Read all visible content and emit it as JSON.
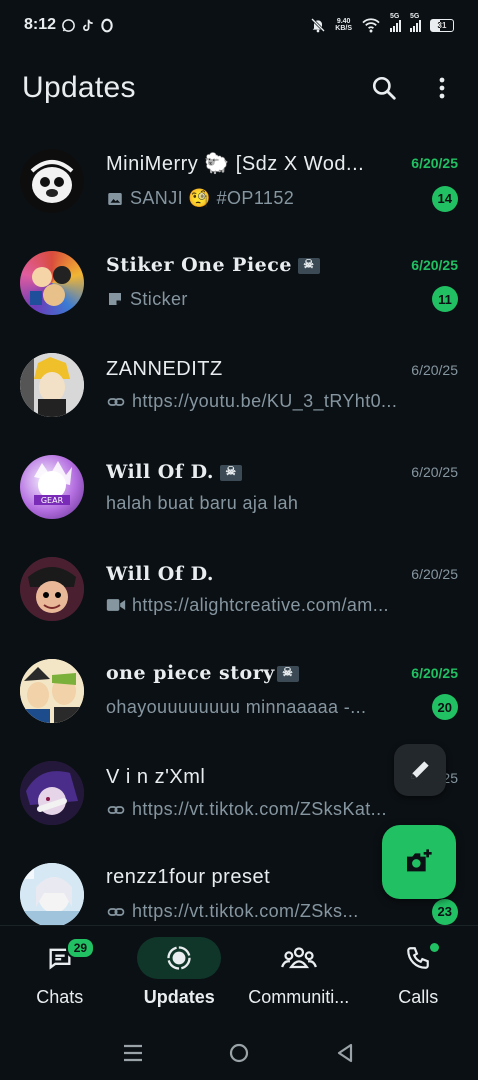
{
  "status_bar": {
    "time": "8:12",
    "net_speed_value": "9.40",
    "net_speed_unit": "KB/S",
    "sim1_label": "5G",
    "sim2_label": "5G",
    "battery": "31"
  },
  "header": {
    "title": "Updates"
  },
  "chats": [
    {
      "name": "MiniMerry 🐑 [Sdz X Wod...",
      "preview": "SANJI 🧐 #OP1152",
      "time": "6/20/25",
      "unread": "14",
      "preview_icon": "image-icon"
    },
    {
      "name": "Stiker One Piece",
      "preview": "Sticker",
      "time": "6/20/25",
      "unread": "11",
      "preview_icon": "sticker-icon"
    },
    {
      "name": "ZANNEDITZ",
      "preview": "https://youtu.be/KU_3_tRYht0...",
      "time": "6/20/25",
      "unread": "",
      "preview_icon": "link-icon"
    },
    {
      "name": "Will Of D.",
      "preview": "halah buat baru aja lah",
      "time": "6/20/25",
      "unread": "",
      "preview_icon": ""
    },
    {
      "name": "Will Of D.",
      "preview": "https://alightcreative.com/am...",
      "time": "6/20/25",
      "unread": "",
      "preview_icon": "video-icon"
    },
    {
      "name": "one piece story",
      "preview": "ohayouuuuuuuu minnaaaaa  -...",
      "time": "6/20/25",
      "unread": "20",
      "preview_icon": ""
    },
    {
      "name": "V i n z'Xml",
      "preview": "https://vt.tiktok.com/ZSksKat...",
      "time": "25",
      "unread": "",
      "preview_icon": "link-icon"
    },
    {
      "name": "renzz1four preset",
      "preview": "https://vt.tiktok.com/ZSks...",
      "time": "",
      "unread": "23",
      "preview_icon": "link-icon"
    }
  ],
  "bottom_nav": {
    "chats_label": "Chats",
    "chats_badge": "29",
    "updates_label": "Updates",
    "communities_label": "Communiti...",
    "calls_label": "Calls"
  },
  "colors": {
    "background": "#0b1014",
    "accent": "#21c063",
    "secondary_text": "#8696a0",
    "active_pill": "#103629"
  }
}
